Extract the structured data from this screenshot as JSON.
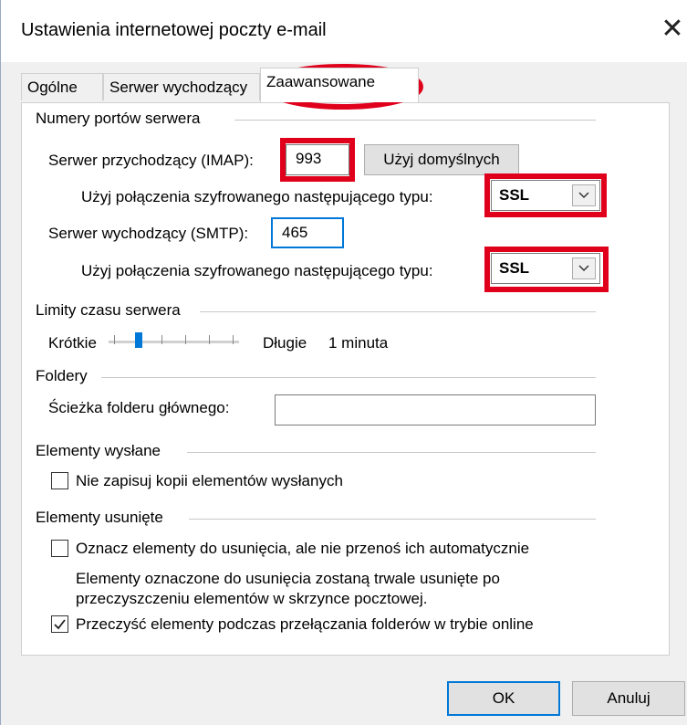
{
  "window": {
    "title": "Ustawienia internetowej poczty e-mail",
    "close_glyph": "✕"
  },
  "tabs": [
    {
      "label": "Ogólne"
    },
    {
      "label": "Serwer wychodzący"
    },
    {
      "label": "Zaawansowane"
    }
  ],
  "ports": {
    "section": "Numery portów serwera",
    "imap_label": "Serwer przychodzący (IMAP):",
    "imap_value": "993",
    "default_button": "Użyj domyślnych",
    "enc_label": "Użyj połączenia szyfrowanego następującego typu:",
    "imap_enc": "SSL",
    "smtp_label": "Serwer wychodzący (SMTP):",
    "smtp_value": "465",
    "smtp_enc": "SSL"
  },
  "timeouts": {
    "section": "Limity czasu serwera",
    "short": "Krótkie",
    "long": "Długie",
    "value": "1 minuta",
    "level_fraction": 0.2
  },
  "folders": {
    "section": "Foldery",
    "root_label": "Ścieżka folderu głównego:",
    "root_value": ""
  },
  "sent": {
    "section": "Elementy wysłane",
    "no_copy_label": "Nie zapisuj kopii elementów wysłanych",
    "no_copy_checked": false
  },
  "deleted": {
    "section": "Elementy usunięte",
    "mark_label": "Oznacz elementy do usunięcia, ale nie przenoś ich automatycznie",
    "mark_checked": false,
    "note_line1": "Elementy oznaczone do usunięcia zostaną trwale usunięte po",
    "note_line2": "przeczyszczeniu elementów w skrzynce pocztowej.",
    "purge_label": "Przeczyść elementy podczas przełączania folderów w trybie online",
    "purge_checked": true
  },
  "buttons": {
    "ok": "OK",
    "cancel": "Anuluj"
  },
  "colors": {
    "annotation_red": "#e0001b",
    "accent_blue": "#0078d7"
  }
}
